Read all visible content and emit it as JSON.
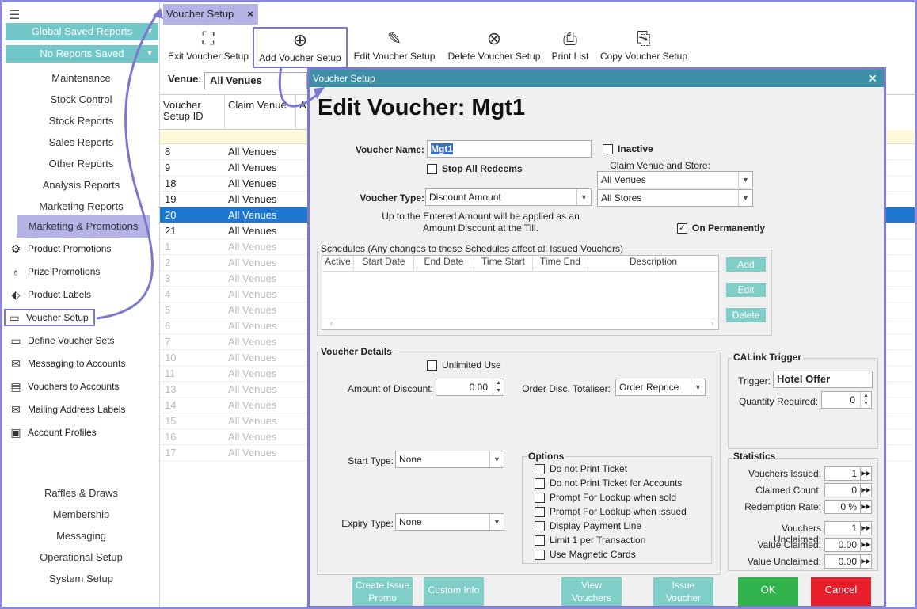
{
  "sidebar": {
    "global_saved_reports": "Global Saved Reports",
    "no_reports_saved": "No Reports Saved",
    "menu": [
      "Maintenance",
      "Stock Control",
      "Stock Reports",
      "Sales Reports",
      "Other Reports",
      "Analysis Reports",
      "Marketing Reports",
      "Marketing & Promotions"
    ],
    "sub": [
      "Product Promotions",
      "Prize Promotions",
      "Product Labels",
      "Voucher Setup",
      "Define Voucher Sets",
      "Messaging to Accounts",
      "Vouchers to Accounts",
      "Mailing Address Labels",
      "Account Profiles"
    ],
    "bottom": [
      "Raffles & Draws",
      "Membership",
      "Messaging",
      "Operational Setup",
      "System Setup"
    ]
  },
  "tab": {
    "label": "Voucher Setup",
    "close": "×"
  },
  "toolbar": [
    "Exit Voucher Setup",
    "Add Voucher Setup",
    "Edit Voucher Setup",
    "Delete Voucher Setup",
    "Print List",
    "Copy Voucher Setup"
  ],
  "venue": {
    "label": "Venue:",
    "value": "All Venues"
  },
  "grid": {
    "headers": [
      "Voucher Setup ID",
      "Claim Venue",
      "A"
    ],
    "rows": [
      {
        "id": "8",
        "venue": "All Venues"
      },
      {
        "id": "9",
        "venue": "All Venues"
      },
      {
        "id": "18",
        "venue": "All Venues"
      },
      {
        "id": "19",
        "venue": "All Venues"
      },
      {
        "id": "20",
        "venue": "All Venues"
      },
      {
        "id": "21",
        "venue": "All Venues"
      },
      {
        "id": "1",
        "venue": "All Venues"
      },
      {
        "id": "2",
        "venue": "All Venues"
      },
      {
        "id": "3",
        "venue": "All Venues"
      },
      {
        "id": "4",
        "venue": "All Venues"
      },
      {
        "id": "5",
        "venue": "All Venues"
      },
      {
        "id": "6",
        "venue": "All Venues"
      },
      {
        "id": "7",
        "venue": "All Venues"
      },
      {
        "id": "10",
        "venue": "All Venues"
      },
      {
        "id": "11",
        "venue": "All Venues"
      },
      {
        "id": "13",
        "venue": "All Venues"
      },
      {
        "id": "14",
        "venue": "All Venues"
      },
      {
        "id": "15",
        "venue": "All Venues"
      },
      {
        "id": "16",
        "venue": "All Venues"
      },
      {
        "id": "17",
        "venue": "All Venues"
      }
    ]
  },
  "dialog": {
    "title": "Voucher Setup",
    "heading": "Edit Voucher: Mgt1",
    "voucher_name_label": "Voucher Name:",
    "voucher_name": "Mgt1",
    "inactive": "Inactive",
    "stop_all_redeems": "Stop All Redeems",
    "claim_venue_label": "Claim Venue and Store:",
    "claim_venue": "All Venues",
    "claim_store": "All Stores",
    "voucher_type_label": "Voucher Type:",
    "voucher_type": "Discount Amount",
    "type_desc": "Up to the Entered Amount will be applied as an Amount Discount at the Till.",
    "on_permanently": "On Permanently",
    "schedules_title": "Schedules (Any changes to these Schedules affect all Issued Vouchers)",
    "sched_cols": [
      "Active",
      "Start Date",
      "End Date",
      "Time Start",
      "Time End",
      "Description"
    ],
    "sched_add": "Add",
    "sched_edit": "Edit",
    "sched_delete": "Delete",
    "details_title": "Voucher Details",
    "unlimited_use": "Unlimited Use",
    "amount_label": "Amount of Discount:",
    "amount": "0.00",
    "totaliser_label": "Order Disc. Totaliser:",
    "totaliser": "Order Reprice",
    "start_type_label": "Start Type:",
    "start_type": "None",
    "expiry_type_label": "Expiry Type:",
    "expiry_type": "None",
    "options_title": "Options",
    "options": [
      "Do not Print Ticket",
      "Do not Print Ticket for Accounts",
      "Prompt For Lookup when sold",
      "Prompt For Lookup when issued",
      "Display Payment Line",
      "Limit 1 per Transaction",
      "Use Magnetic Cards"
    ],
    "calink_title": "CALink Trigger",
    "trigger_label": "Trigger:",
    "trigger": "Hotel Offer",
    "qty_label": "Quantity Required:",
    "qty": "0",
    "stats_title": "Statistics",
    "stats": [
      {
        "label": "Vouchers Issued:",
        "value": "1"
      },
      {
        "label": "Claimed Count:",
        "value": "0"
      },
      {
        "label": "Redemption Rate:",
        "value": "0 %"
      },
      {
        "label": "Vouchers Unclaimed:",
        "value": "1"
      },
      {
        "label": "Value Claimed:",
        "value": "0.00"
      },
      {
        "label": "Value Unclaimed:",
        "value": "0.00"
      }
    ],
    "btn_create": "Create Issue Promo",
    "btn_custom": "Custom Info",
    "btn_view": "View Vouchers",
    "btn_issue": "Issue Voucher",
    "btn_ok": "OK",
    "btn_cancel": "Cancel"
  },
  "colors": {
    "teal": "#71c7c7",
    "accent": "#7b78d0",
    "ok": "#2fb34a",
    "cancel": "#e81e2b",
    "selected": "#1e78d0"
  }
}
